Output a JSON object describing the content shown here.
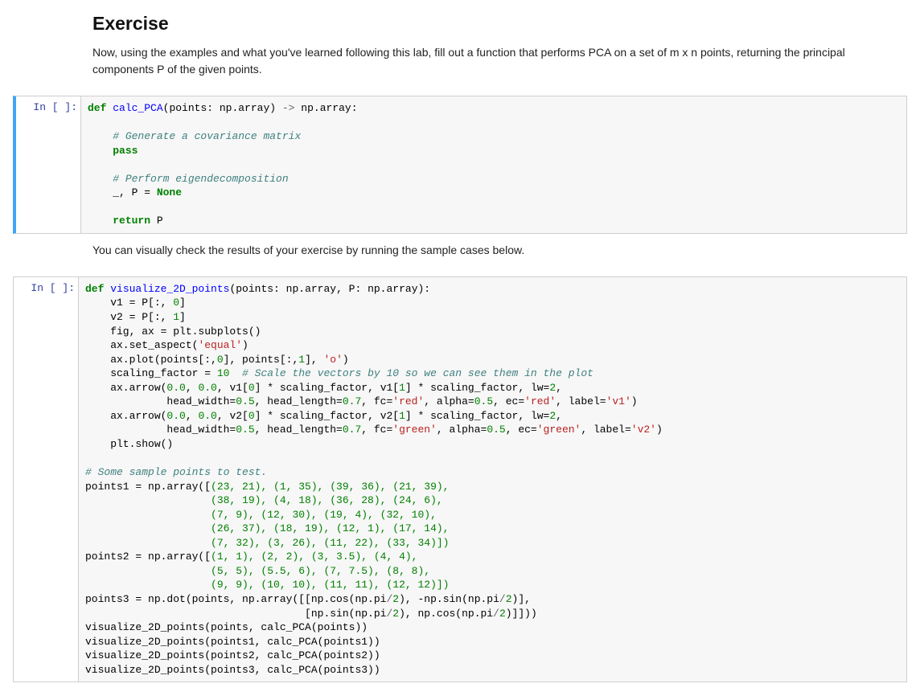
{
  "markdown": {
    "heading": "Exercise",
    "para1": "Now, using the examples and what you've learned following this lab, fill out a function that performs PCA on a set of m x n points, returning the principal components P of the given points.",
    "para2": "You can visually check the results of your exercise by running the sample cases below."
  },
  "prompts": {
    "cell1": "In [ ]:",
    "cell2": "In [ ]:"
  },
  "code1": {
    "l1_def": "def",
    "l1_name": "calc_PCA",
    "l1_sig_open": "(points: np.array) ",
    "l1_arrow": "->",
    "l1_sig_close": " np.array:",
    "l3_comment": "# Generate a covariance matrix",
    "l4_pass": "pass",
    "l6_comment": "# Perform eigendecomposition",
    "l7_lhs": "    _, P = ",
    "l7_none": "None",
    "l9_return": "return",
    "l9_rest": " P"
  },
  "code2": {
    "def": "def",
    "name": "visualize_2D_points",
    "sig": "(points: np.array, P: np.array):",
    "l_v1": "    v1 = P[:, ",
    "l_v1_n": "0",
    "l_v1_c": "]",
    "l_v2": "    v2 = P[:, ",
    "l_v2_n": "1",
    "l_v2_c": "]",
    "l_fig": "    fig, ax = plt.subplots()",
    "l_aspect_a": "    ax.set_aspect(",
    "l_aspect_s": "'equal'",
    "l_aspect_c": ")",
    "l_plot_a": "    ax.plot(points[:,",
    "l_plot_n0": "0",
    "l_plot_b": "], points[:,",
    "l_plot_n1": "1",
    "l_plot_c": "], ",
    "l_plot_s": "'o'",
    "l_plot_d": ")",
    "l_sf_a": "    scaling_factor = ",
    "l_sf_n": "10",
    "l_sf_b": "  ",
    "l_sf_c": "# Scale the vectors by 10 so we can see them in the plot",
    "l_ar1_a": "    ax.arrow(",
    "l_ar1_n1": "0.0",
    "l_ar1_b": ", ",
    "l_ar1_n2": "0.0",
    "l_ar1_c": ", v1[",
    "l_ar1_n3": "0",
    "l_ar1_d": "] * scaling_factor, v1[",
    "l_ar1_n4": "1",
    "l_ar1_e": "] * scaling_factor, lw=",
    "l_ar1_n5": "2",
    "l_ar1_f": ",",
    "l_ar1b_a": "             head_width=",
    "l_ar1b_n1": "0.5",
    "l_ar1b_b": ", head_length=",
    "l_ar1b_n2": "0.7",
    "l_ar1b_c": ", fc=",
    "l_ar1b_s1": "'red'",
    "l_ar1b_d": ", alpha=",
    "l_ar1b_n3": "0.5",
    "l_ar1b_e": ", ec=",
    "l_ar1b_s2": "'red'",
    "l_ar1b_f": ", label=",
    "l_ar1b_s3": "'v1'",
    "l_ar1b_g": ")",
    "l_ar2_a": "    ax.arrow(",
    "l_ar2_n1": "0.0",
    "l_ar2_b": ", ",
    "l_ar2_n2": "0.0",
    "l_ar2_c": ", v2[",
    "l_ar2_n3": "0",
    "l_ar2_d": "] * scaling_factor, v2[",
    "l_ar2_n4": "1",
    "l_ar2_e": "] * scaling_factor, lw=",
    "l_ar2_n5": "2",
    "l_ar2_f": ",",
    "l_ar2b_a": "             head_width=",
    "l_ar2b_n1": "0.5",
    "l_ar2b_b": ", head_length=",
    "l_ar2b_n2": "0.7",
    "l_ar2b_c": ", fc=",
    "l_ar2b_s1": "'green'",
    "l_ar2b_d": ", alpha=",
    "l_ar2b_n3": "0.5",
    "l_ar2b_e": ", ec=",
    "l_ar2b_s2": "'green'",
    "l_ar2b_f": ", label=",
    "l_ar2b_s3": "'v2'",
    "l_ar2b_g": ")",
    "l_show": "    plt.show()",
    "l_blank": "",
    "l_cm": "# Some sample points to test.",
    "p1_head": "points1 = np.array([",
    "p1_r1": "(23, 21), (1, 35), (39, 36), (21, 39),",
    "p1_r2": "                    (38, 19), (4, 18), (36, 28), (24, 6),",
    "p1_r3": "                    (7, 9), (12, 30), (19, 4), (32, 10),",
    "p1_r4": "                    (26, 37), (18, 19), (12, 1), (17, 14),",
    "p1_r5": "                    (7, 32), (3, 26), (11, 22), (33, 34)])",
    "p2_head": "points2 = np.array([",
    "p2_r1": "(1, 1), (2, 2), (3, 3.5), (4, 4),",
    "p2_r2": "                    (5, 5), (5.5, 6), (7, 7.5), (8, 8),",
    "p2_r3": "                    (9, 9), (10, 10), (11, 11), (12, 12)])",
    "p3_a": "points3 = np.dot(points, np.array([[np.cos(np.pi",
    "p3_div": "/",
    "p3_two": "2",
    "p3_b": "), -np.sin(np.pi",
    "p3_c": ")],",
    "p3_l2_a": "                                   [np.sin(np.pi",
    "p3_l2_b": "), np.cos(np.pi",
    "p3_l2_c": ")]]))",
    "vz_a": "visualize_2D_points(points, calc_PCA(points))",
    "vz_b": "visualize_2D_points(points1, calc_PCA(points1))",
    "vz_c": "visualize_2D_points(points2, calc_PCA(points2))",
    "vz_d": "visualize_2D_points(points3, calc_PCA(points3))"
  }
}
